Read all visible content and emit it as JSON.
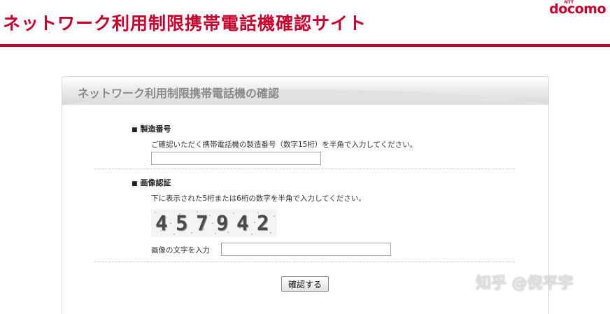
{
  "header": {
    "title": "ネットワーク利用制限携帯電話機確認サイト",
    "logo_small": "NTT",
    "logo_brand": "docomo"
  },
  "panel": {
    "title": "ネットワーク利用制限携帯電話機の確認"
  },
  "serial": {
    "bullet": "■",
    "label": "製造番号",
    "help": "ご確認いただく携帯電話機の製造番号（数字15桁）を半角で入力してください。",
    "value": ""
  },
  "captcha": {
    "bullet": "■",
    "label": "画像認証",
    "help": "下に表示された5桁または6桁の数字を半角で入力してください。",
    "digits": [
      "4",
      "5",
      "7",
      "9",
      "4",
      "2"
    ],
    "input_label": "画像の文字を入力",
    "value": ""
  },
  "submit": {
    "label": "確認する"
  },
  "watermark": "知乎 @倪平宇",
  "colors": {
    "brand": "#c8002d",
    "panel_title": "#8a8a8a"
  }
}
